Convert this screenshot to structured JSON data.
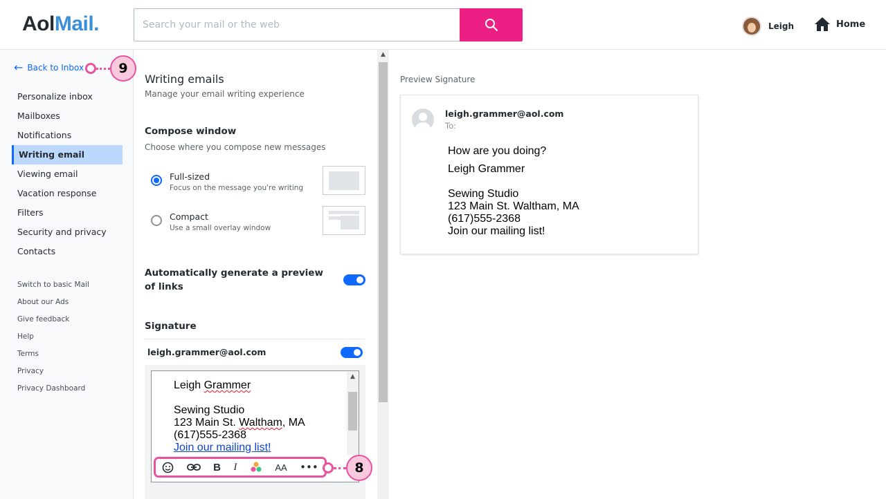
{
  "header": {
    "logo_aol": "Aol",
    "logo_mail": "Mail.",
    "search_placeholder": "Search your mail or the web",
    "user_name": "Leigh",
    "home_label": "Home"
  },
  "sidebar": {
    "back_label": "Back to Inbox",
    "items": [
      {
        "label": "Personalize inbox"
      },
      {
        "label": "Mailboxes"
      },
      {
        "label": "Notifications"
      },
      {
        "label": "Writing email"
      },
      {
        "label": "Viewing email"
      },
      {
        "label": "Vacation response"
      },
      {
        "label": "Filters"
      },
      {
        "label": "Security and privacy"
      },
      {
        "label": "Contacts"
      }
    ],
    "active_item": "Writing email",
    "secondary": [
      {
        "label": "Switch to basic Mail"
      },
      {
        "label": "About our Ads"
      },
      {
        "label": "Give feedback"
      },
      {
        "label": "Help"
      },
      {
        "label": "Terms"
      },
      {
        "label": "Privacy"
      },
      {
        "label": "Privacy Dashboard"
      }
    ]
  },
  "settings": {
    "title": "Writing emails",
    "subtitle": "Manage your email writing experience",
    "compose": {
      "title": "Compose window",
      "subtitle": "Choose where you compose new messages",
      "options": [
        {
          "label": "Full-sized",
          "desc": "Focus on the message you're writing",
          "selected": true
        },
        {
          "label": "Compact",
          "desc": "Use a small overlay window",
          "selected": false
        }
      ]
    },
    "link_preview": {
      "label": "Automatically generate a preview of links",
      "enabled": true
    },
    "signature": {
      "title": "Signature",
      "account": "leigh.grammer@aol.com",
      "enabled": true,
      "editor_lines": [
        "Leigh Grammer",
        "Sewing Studio",
        "123 Main St. Waltham, MA",
        "(617)555-2368",
        "Join our mailing list!"
      ]
    }
  },
  "preview": {
    "label": "Preview Signature",
    "from": "leigh.grammer@aol.com",
    "to_label": "To:",
    "greeting": "How are you doing?",
    "lines": [
      "Leigh Grammer",
      "Sewing Studio",
      "123 Main St. Waltham, MA",
      "(617)555-2368",
      "Join our mailing list!"
    ]
  },
  "callouts": {
    "back": "9",
    "toolbar": "8"
  },
  "colors": {
    "accent": "#0f69ff",
    "search_button": "#ec1f85",
    "callout": "#e8529f",
    "active_nav_bg": "#bcd8ff"
  }
}
